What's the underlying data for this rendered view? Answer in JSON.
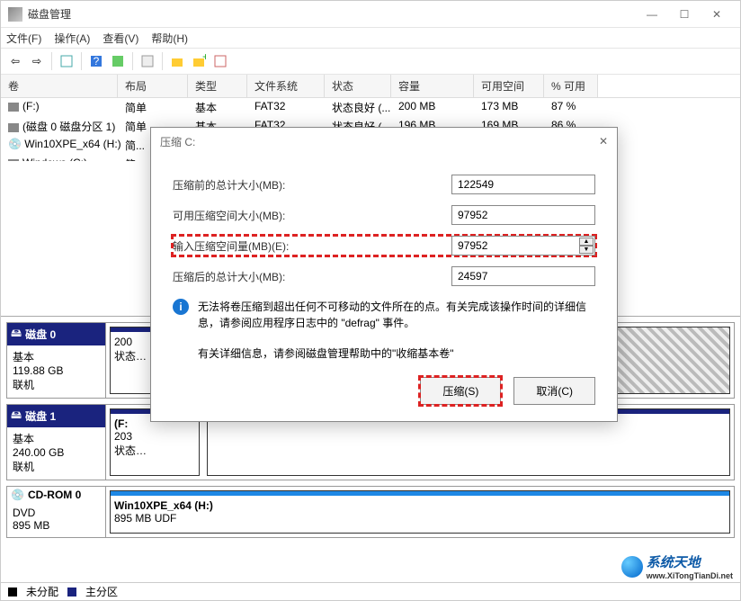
{
  "window": {
    "title": "磁盘管理"
  },
  "menu": {
    "file": "文件(F)",
    "action": "操作(A)",
    "view": "查看(V)",
    "help": "帮助(H)"
  },
  "columns": {
    "vol": "卷",
    "layout": "布局",
    "type": "类型",
    "fs": "文件系统",
    "status": "状态",
    "cap": "容量",
    "free": "可用空间",
    "pct": "% 可用"
  },
  "rows": [
    {
      "vol": "(F:)",
      "layout": "简单",
      "type": "基本",
      "fs": "FAT32",
      "status": "状态良好 (...",
      "cap": "200 MB",
      "free": "173 MB",
      "pct": "87 %"
    },
    {
      "vol": "(磁盘 0 磁盘分区 1)",
      "layout": "简单",
      "type": "基本",
      "fs": "FAT32",
      "status": "状态良好 (...",
      "cap": "196 MB",
      "free": "169 MB",
      "pct": "86 %"
    },
    {
      "vol": "Win10XPE_x64 (H:)",
      "layout": "简...",
      "type": "",
      "fs": "",
      "status": "",
      "cap": "",
      "free": "",
      "pct": ""
    },
    {
      "vol": "Windows (C:)",
      "layout": "简...",
      "type": "",
      "fs": "",
      "status": "",
      "cap": "",
      "free": "",
      "pct": ""
    }
  ],
  "dialog": {
    "title": "压缩 C:",
    "total_before_lbl": "压缩前的总计大小(MB):",
    "total_before_val": "122549",
    "avail_lbl": "可用压缩空间大小(MB):",
    "avail_val": "97952",
    "input_lbl": "输入压缩空间量(MB)(E):",
    "input_val": "97952",
    "after_lbl": "压缩后的总计大小(MB):",
    "after_val": "24597",
    "info1": "无法将卷压缩到超出任何不可移动的文件所在的点。有关完成该操作时间的详细信息，请参阅应用程序日志中的 \"defrag\" 事件。",
    "info2": "有关详细信息，请参阅磁盘管理帮助中的\"收缩基本卷\"",
    "btn_shrink": "压缩(S)",
    "btn_cancel": "取消(C)"
  },
  "disks": {
    "d0": {
      "name": "磁盘 0",
      "type": "基本",
      "size": "119.88 GB",
      "state": "联机",
      "p1": "200",
      "p1s": "状态…"
    },
    "d1": {
      "name": "磁盘 1",
      "type": "基本",
      "size": "240.00 GB",
      "state": "联机",
      "p1": "(F:",
      "p1b": "203",
      "p1s": "状态…"
    },
    "cd": {
      "name": "CD-ROM 0",
      "type": "DVD",
      "size": "895 MB",
      "state": "",
      "p1": "Win10XPE_x64  (H:)",
      "p1b": "895 MB UDF"
    }
  },
  "legend": {
    "unalloc": "未分配",
    "primary": "主分区"
  },
  "watermark": {
    "brand": "系统天地",
    "url": "www.XiTongTianDi.net"
  },
  "colors": {
    "navy": "#1a237e",
    "blue": "#1e88e5"
  }
}
